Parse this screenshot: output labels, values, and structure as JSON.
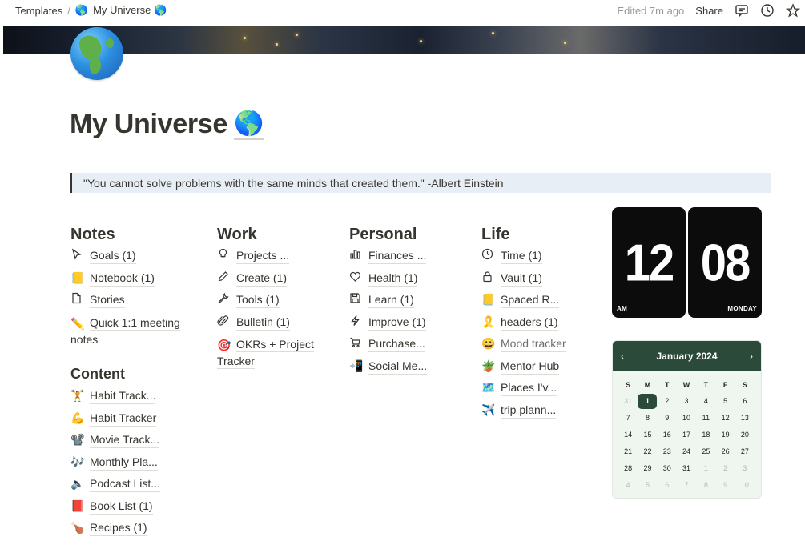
{
  "topbar": {
    "breadcrumb_parent": "Templates",
    "breadcrumb_separator": "/",
    "breadcrumb_current": "My Universe",
    "edited": "Edited 7m ago",
    "share": "Share",
    "icons": [
      "comment-icon",
      "history-clock-icon",
      "star-icon"
    ]
  },
  "page": {
    "title": "My Universe",
    "icon": "globe-americas-emoji",
    "quote": "\"You cannot solve problems with the same minds that created them.\" -Albert Einstein"
  },
  "notes": {
    "heading": "Notes",
    "items": [
      {
        "icon": "cursor-icon",
        "label": "Goals (1)"
      },
      {
        "icon": "📒",
        "label": "Notebook (1)"
      },
      {
        "icon": "page-icon",
        "label": "Stories"
      },
      {
        "icon": "✏️",
        "label": "Quick 1:1 meeting notes"
      }
    ]
  },
  "content": {
    "heading": "Content",
    "items": [
      {
        "icon": "🏋️",
        "label": "Habit Track..."
      },
      {
        "icon": "💪",
        "label": "Habit Tracker"
      },
      {
        "icon": "📽️",
        "label": "Movie Track..."
      },
      {
        "icon": "🎶",
        "label": "Monthly Pla..."
      },
      {
        "icon": "🔈",
        "label": "Podcast List..."
      },
      {
        "icon": "📕",
        "label": "Book List (1)"
      },
      {
        "icon": "🍗",
        "label": "Recipes (1)"
      }
    ]
  },
  "work": {
    "heading": "Work",
    "items": [
      {
        "icon": "lightbulb-icon",
        "label": "Projects ..."
      },
      {
        "icon": "pencil-icon",
        "label": "Create (1)"
      },
      {
        "icon": "wrench-icon",
        "label": "Tools (1)"
      },
      {
        "icon": "paperclip-icon",
        "label": "Bulletin (1)"
      },
      {
        "icon": "🎯",
        "label": "OKRs + Project Tracker"
      }
    ]
  },
  "personal": {
    "heading": "Personal",
    "items": [
      {
        "icon": "bar-chart-icon",
        "label": "Finances ..."
      },
      {
        "icon": "heart-icon",
        "label": "Health (1)"
      },
      {
        "icon": "floppy-disk-icon",
        "label": "Learn (1)"
      },
      {
        "icon": "lightning-icon",
        "label": "Improve (1)"
      },
      {
        "icon": "cart-icon",
        "label": "Purchase..."
      },
      {
        "icon": "📲",
        "label": "Social Me..."
      }
    ]
  },
  "life": {
    "heading": "Life",
    "items": [
      {
        "icon": "clock-icon",
        "label": "Time (1)"
      },
      {
        "icon": "lock-icon",
        "label": "Vault (1)"
      },
      {
        "icon": "📒",
        "label": "Spaced R..."
      },
      {
        "icon": "🎗️",
        "label": "headers (1)"
      },
      {
        "icon": "😀",
        "label": "Mood tracker"
      },
      {
        "icon": "🪴",
        "label": "Mentor Hub"
      },
      {
        "icon": "🗺️",
        "label": "Places I'v..."
      },
      {
        "icon": "✈️",
        "label": "trip plann..."
      }
    ]
  },
  "clock": {
    "hours": "12",
    "minutes": "08",
    "meridiem": "AM",
    "weekday": "MONDAY"
  },
  "calendar": {
    "month_label": "January 2024",
    "prev": "‹",
    "next": "›",
    "weekdays": [
      "S",
      "M",
      "T",
      "W",
      "T",
      "F",
      "S"
    ],
    "today": "1",
    "days": [
      {
        "d": "31",
        "muted": true
      },
      {
        "d": "1",
        "today": true
      },
      {
        "d": "2"
      },
      {
        "d": "3"
      },
      {
        "d": "4"
      },
      {
        "d": "5"
      },
      {
        "d": "6"
      },
      {
        "d": "7"
      },
      {
        "d": "8"
      },
      {
        "d": "9"
      },
      {
        "d": "10"
      },
      {
        "d": "11"
      },
      {
        "d": "12"
      },
      {
        "d": "13"
      },
      {
        "d": "14"
      },
      {
        "d": "15"
      },
      {
        "d": "16"
      },
      {
        "d": "17"
      },
      {
        "d": "18"
      },
      {
        "d": "19"
      },
      {
        "d": "20"
      },
      {
        "d": "21"
      },
      {
        "d": "22"
      },
      {
        "d": "23"
      },
      {
        "d": "24"
      },
      {
        "d": "25"
      },
      {
        "d": "26"
      },
      {
        "d": "27"
      },
      {
        "d": "28"
      },
      {
        "d": "29"
      },
      {
        "d": "30"
      },
      {
        "d": "31"
      },
      {
        "d": "1",
        "muted": true
      },
      {
        "d": "2",
        "muted": true
      },
      {
        "d": "3",
        "muted": true
      },
      {
        "d": "4",
        "muted": true
      },
      {
        "d": "5",
        "muted": true
      },
      {
        "d": "6",
        "muted": true
      },
      {
        "d": "7",
        "muted": true
      },
      {
        "d": "8",
        "muted": true
      },
      {
        "d": "9",
        "muted": true
      },
      {
        "d": "10",
        "muted": true
      }
    ]
  },
  "colors": {
    "text": "#37352f",
    "quote_bg": "#e7eef5",
    "calendar_accent": "#2b4a3a",
    "calendar_bg": "#eff6f0",
    "clock_bg": "#0c0c0c"
  }
}
